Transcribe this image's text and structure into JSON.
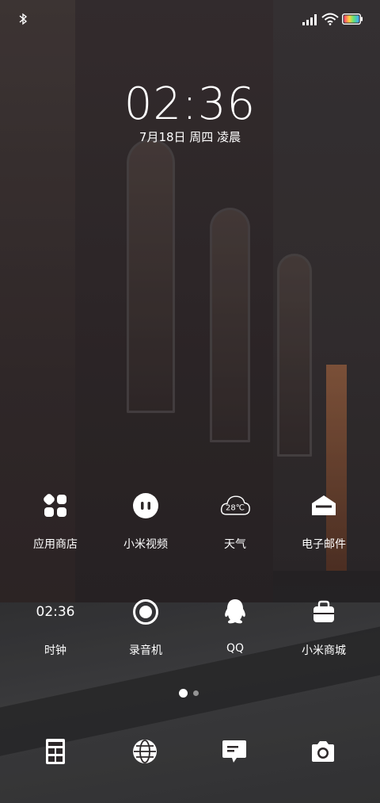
{
  "lockscreen": {
    "time": "02:36",
    "date": "7月18日 周四 凌晨"
  },
  "apps": [
    {
      "label": "应用商店",
      "icon": "app-store-icon"
    },
    {
      "label": "小米视频",
      "icon": "video-icon"
    },
    {
      "label": "天气",
      "icon": "weather-icon",
      "icon_text": "28℃"
    },
    {
      "label": "电子邮件",
      "icon": "mail-icon"
    },
    {
      "label": "时钟",
      "icon": "clock-icon",
      "icon_text": "02:36"
    },
    {
      "label": "录音机",
      "icon": "recorder-icon"
    },
    {
      "label": "QQ",
      "icon": "qq-icon"
    },
    {
      "label": "小米商城",
      "icon": "mi-store-icon"
    }
  ],
  "pages": {
    "count": 2,
    "current": 1
  },
  "dock": [
    "calculator-icon",
    "browser-icon",
    "messages-icon",
    "camera-icon"
  ],
  "status": {
    "icons": [
      "bluetooth-icon",
      "signal-icon",
      "wifi-icon",
      "battery-icon"
    ]
  }
}
